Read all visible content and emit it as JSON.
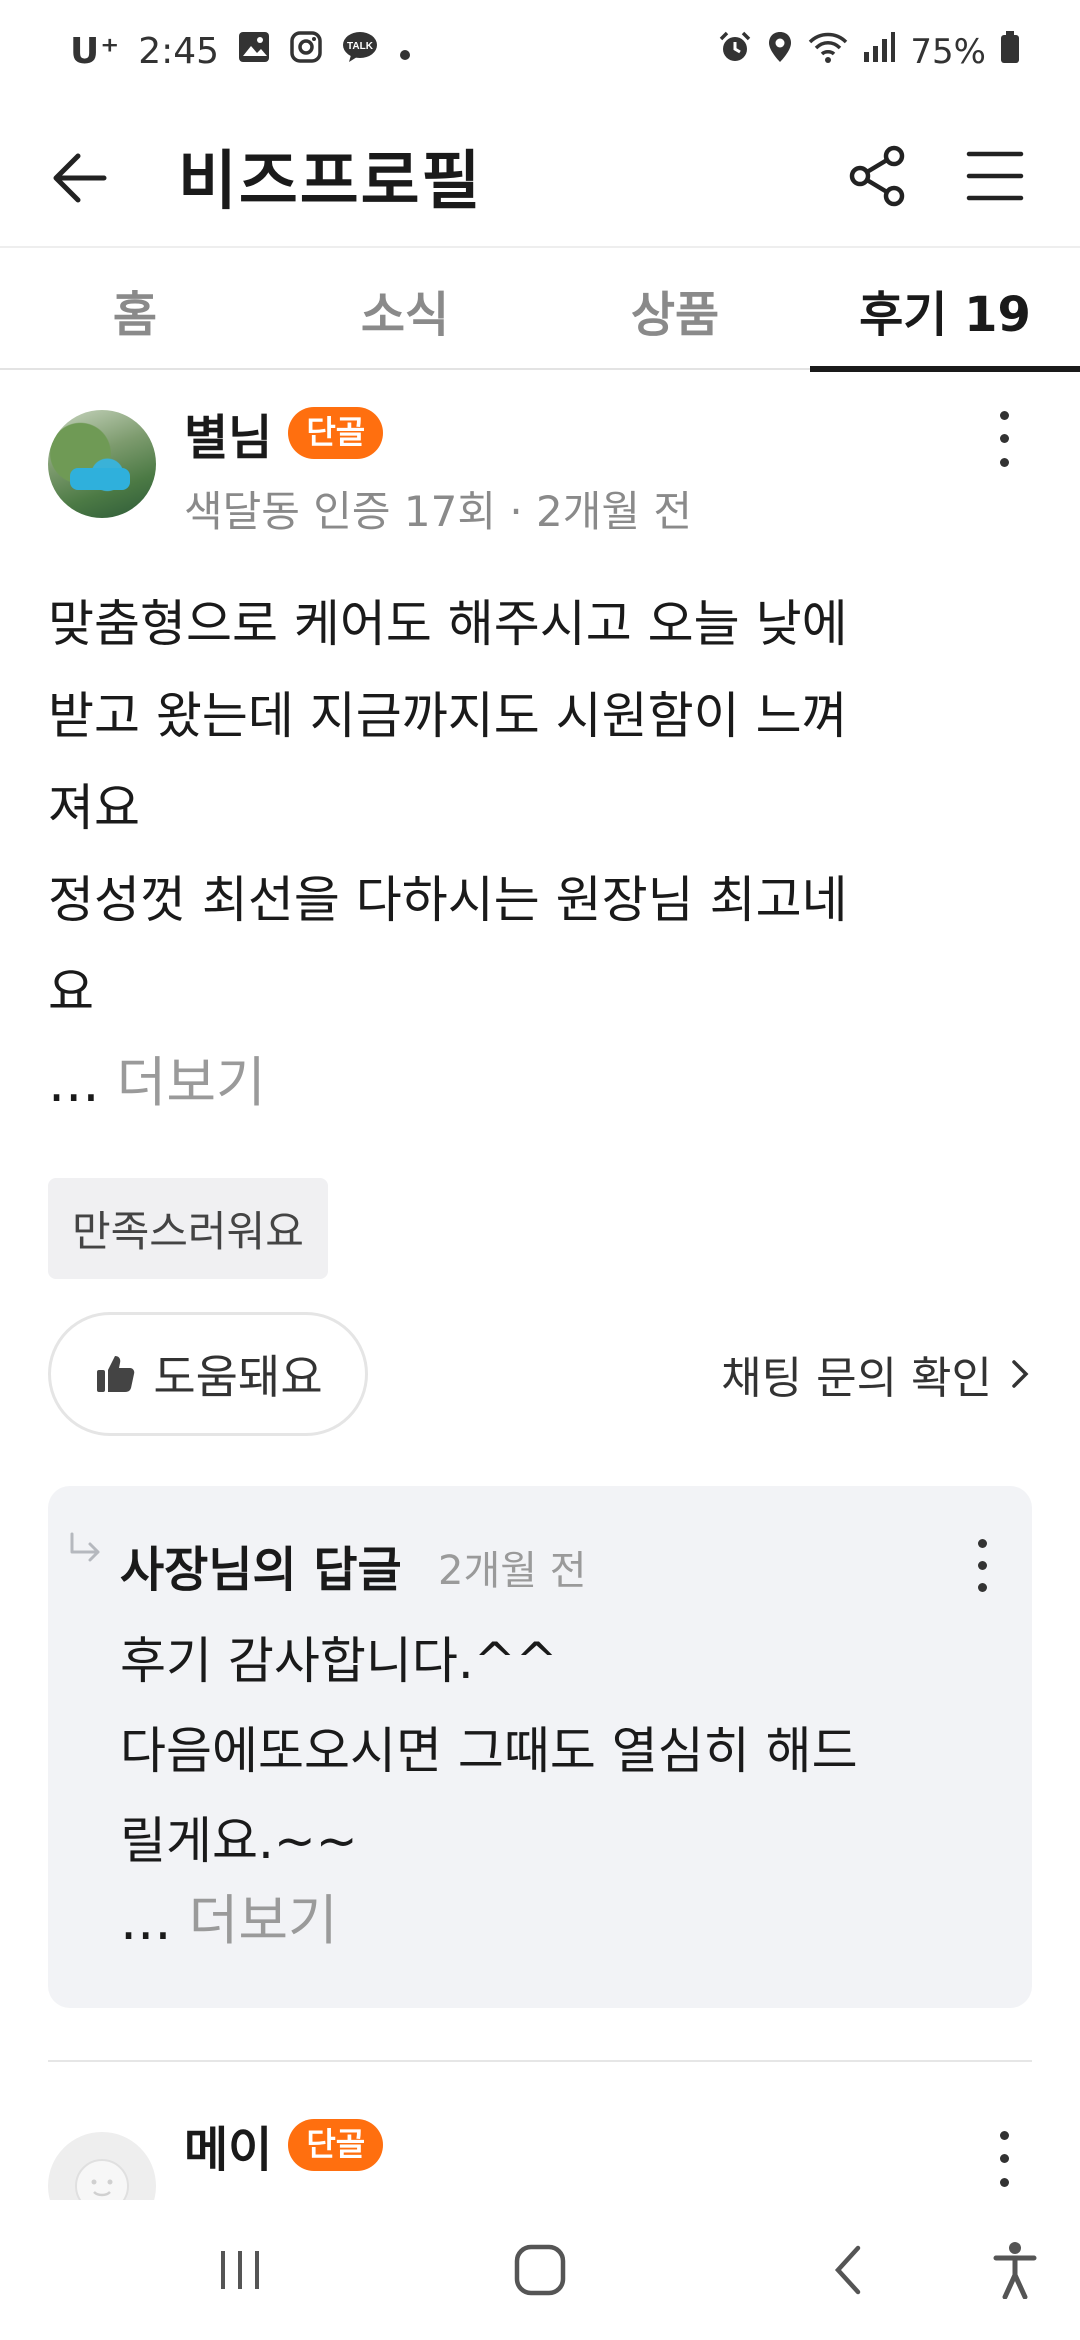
{
  "status_bar": {
    "carrier": "U⁺",
    "time": "2:45",
    "battery": "75%",
    "icons": [
      "gallery-icon",
      "instagram-icon",
      "kakaotalk-icon",
      "dot-icon",
      "alarm-icon",
      "location-icon",
      "wifi-icon",
      "signal-icon",
      "battery-icon"
    ]
  },
  "app_bar": {
    "title": "비즈프로필"
  },
  "tabs": [
    {
      "label": "홈",
      "active": false
    },
    {
      "label": "소식",
      "active": false
    },
    {
      "label": "상품",
      "active": false
    },
    {
      "label": "후기 19",
      "active": true
    }
  ],
  "reviews": [
    {
      "user_name": "별님",
      "badge": "단골",
      "meta": "색달동 인증 17회 · 2개월 전",
      "body": "맞춤형으로 케어도 해주시고 오늘 낮에\n받고 왔는데 지금까지도 시원함이 느껴\n져요\n정성껏 최선을 다하시는 원장님 최고네\n요",
      "more_prefix": "... ",
      "more_label": "더보기",
      "tag": "만족스러워요",
      "helpful_label": "도움돼요",
      "chat_link": "채팅 문의 확인",
      "reply": {
        "title": "사장님의 답글",
        "time": "2개월 전",
        "body": "후기 감사합니다.^^\n다음에또오시면 그때도 열심히 해드\n릴게요.~~",
        "more_prefix": "... ",
        "more_label": "더보기"
      }
    },
    {
      "user_name": "메이",
      "badge": "단골"
    }
  ],
  "colors": {
    "accent": "#ff6f0f",
    "text": "#1a1a1a",
    "muted": "#8a8a8a",
    "reply_bg": "#f2f3f6"
  }
}
